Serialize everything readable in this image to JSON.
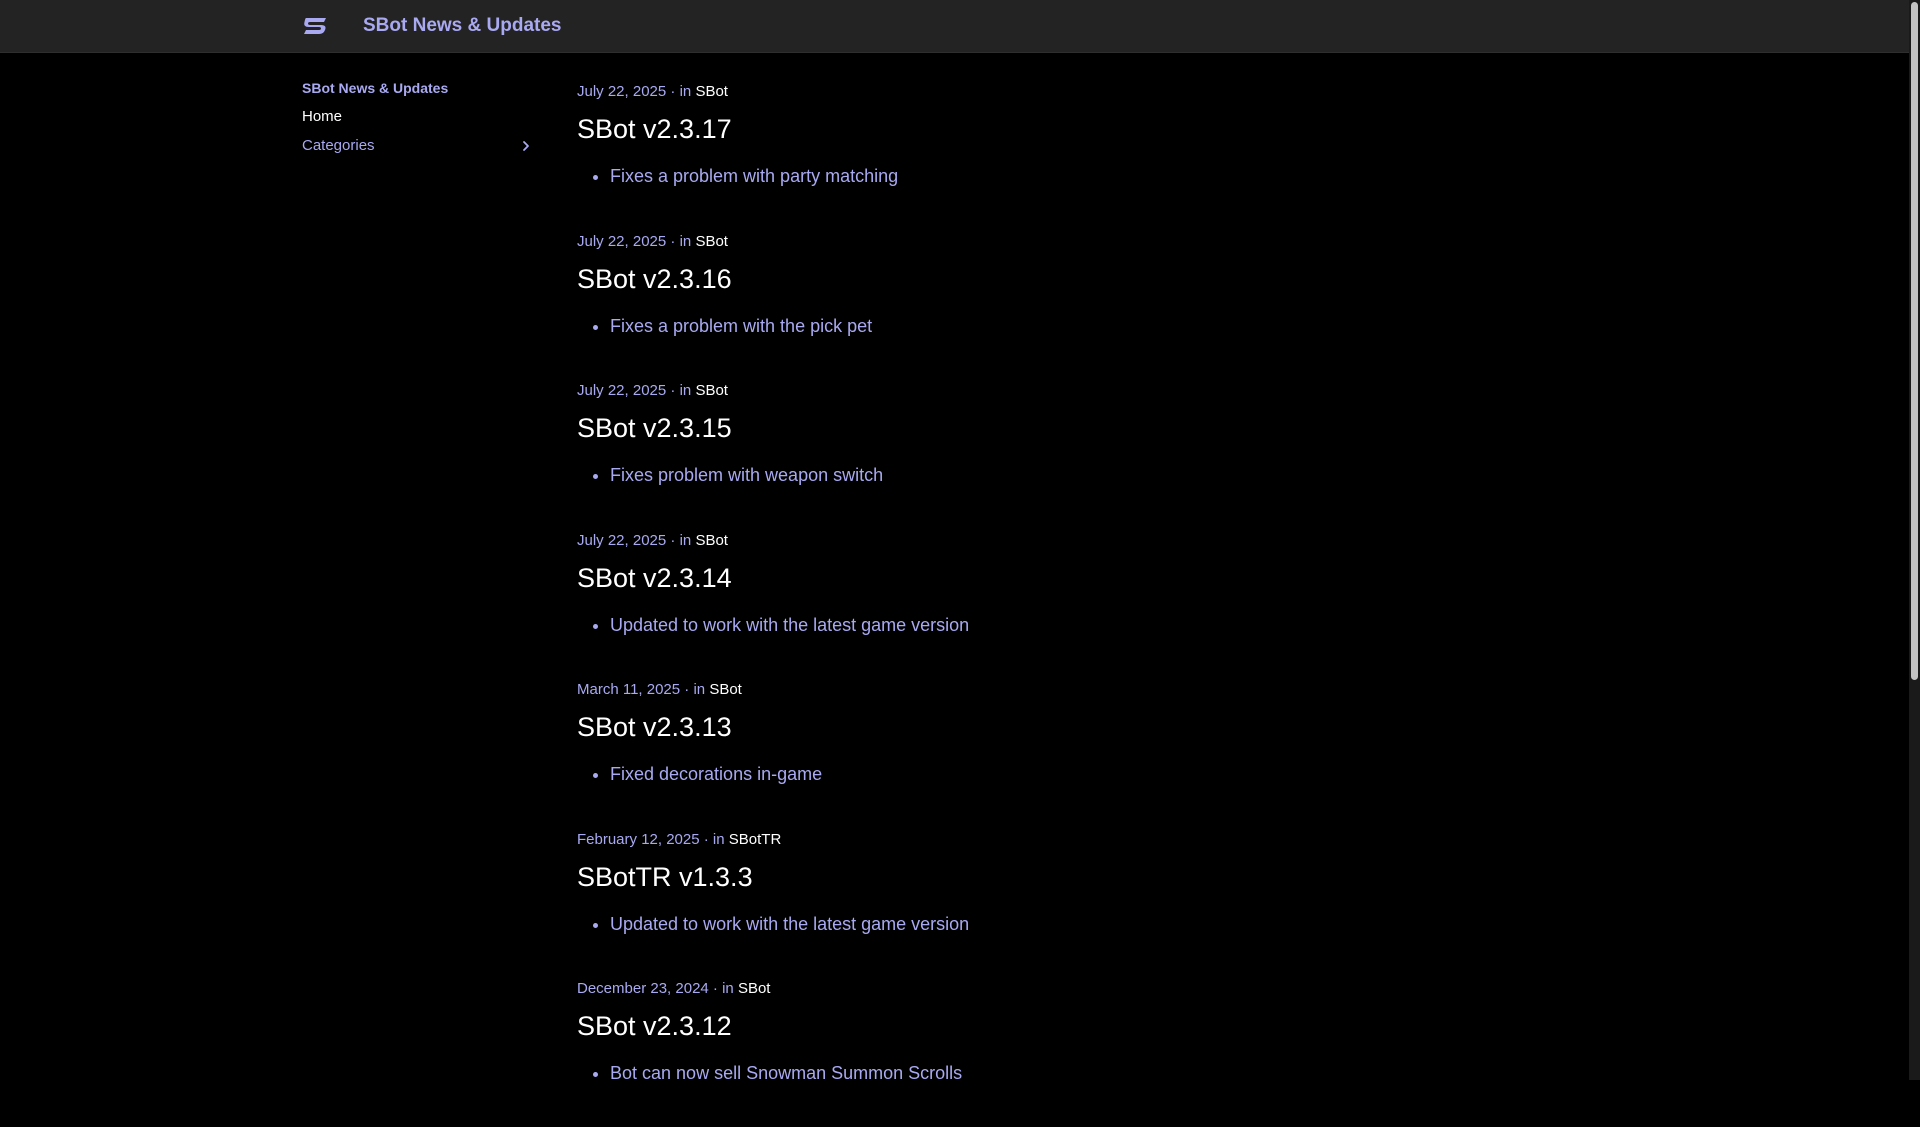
{
  "header": {
    "logo_icon": "sbot-logo-icon",
    "title": "SBot News & Updates",
    "accent_color": "#a9a9f2"
  },
  "sidebar": {
    "heading": "SBot News & Updates",
    "home": "Home",
    "categories": "Categories",
    "categories_icon": "chevron-right-icon"
  },
  "posts": [
    {
      "date": "July 22, 2025",
      "in": "in",
      "category": "SBot",
      "title": "SBot v2.3.17",
      "items": [
        "Fixes a problem with party matching"
      ]
    },
    {
      "date": "July 22, 2025",
      "in": "in",
      "category": "SBot",
      "title": "SBot v2.3.16",
      "items": [
        "Fixes a problem with the pick pet"
      ]
    },
    {
      "date": "July 22, 2025",
      "in": "in",
      "category": "SBot",
      "title": "SBot v2.3.15",
      "items": [
        "Fixes problem with weapon switch"
      ]
    },
    {
      "date": "July 22, 2025",
      "in": "in",
      "category": "SBot",
      "title": "SBot v2.3.14",
      "items": [
        "Updated to work with the latest game version"
      ]
    },
    {
      "date": "March 11, 2025",
      "in": "in",
      "category": "SBot",
      "title": "SBot v2.3.13",
      "items": [
        "Fixed decorations in-game"
      ]
    },
    {
      "date": "February 12, 2025",
      "in": "in",
      "category": "SBotTR",
      "title": "SBotTR v1.3.3",
      "items": [
        "Updated to work with the latest game version"
      ]
    },
    {
      "date": "December 23, 2024",
      "in": "in",
      "category": "SBot",
      "title": "SBot v2.3.12",
      "items": [
        "Bot can now sell Snowman Summon Scrolls"
      ]
    }
  ]
}
